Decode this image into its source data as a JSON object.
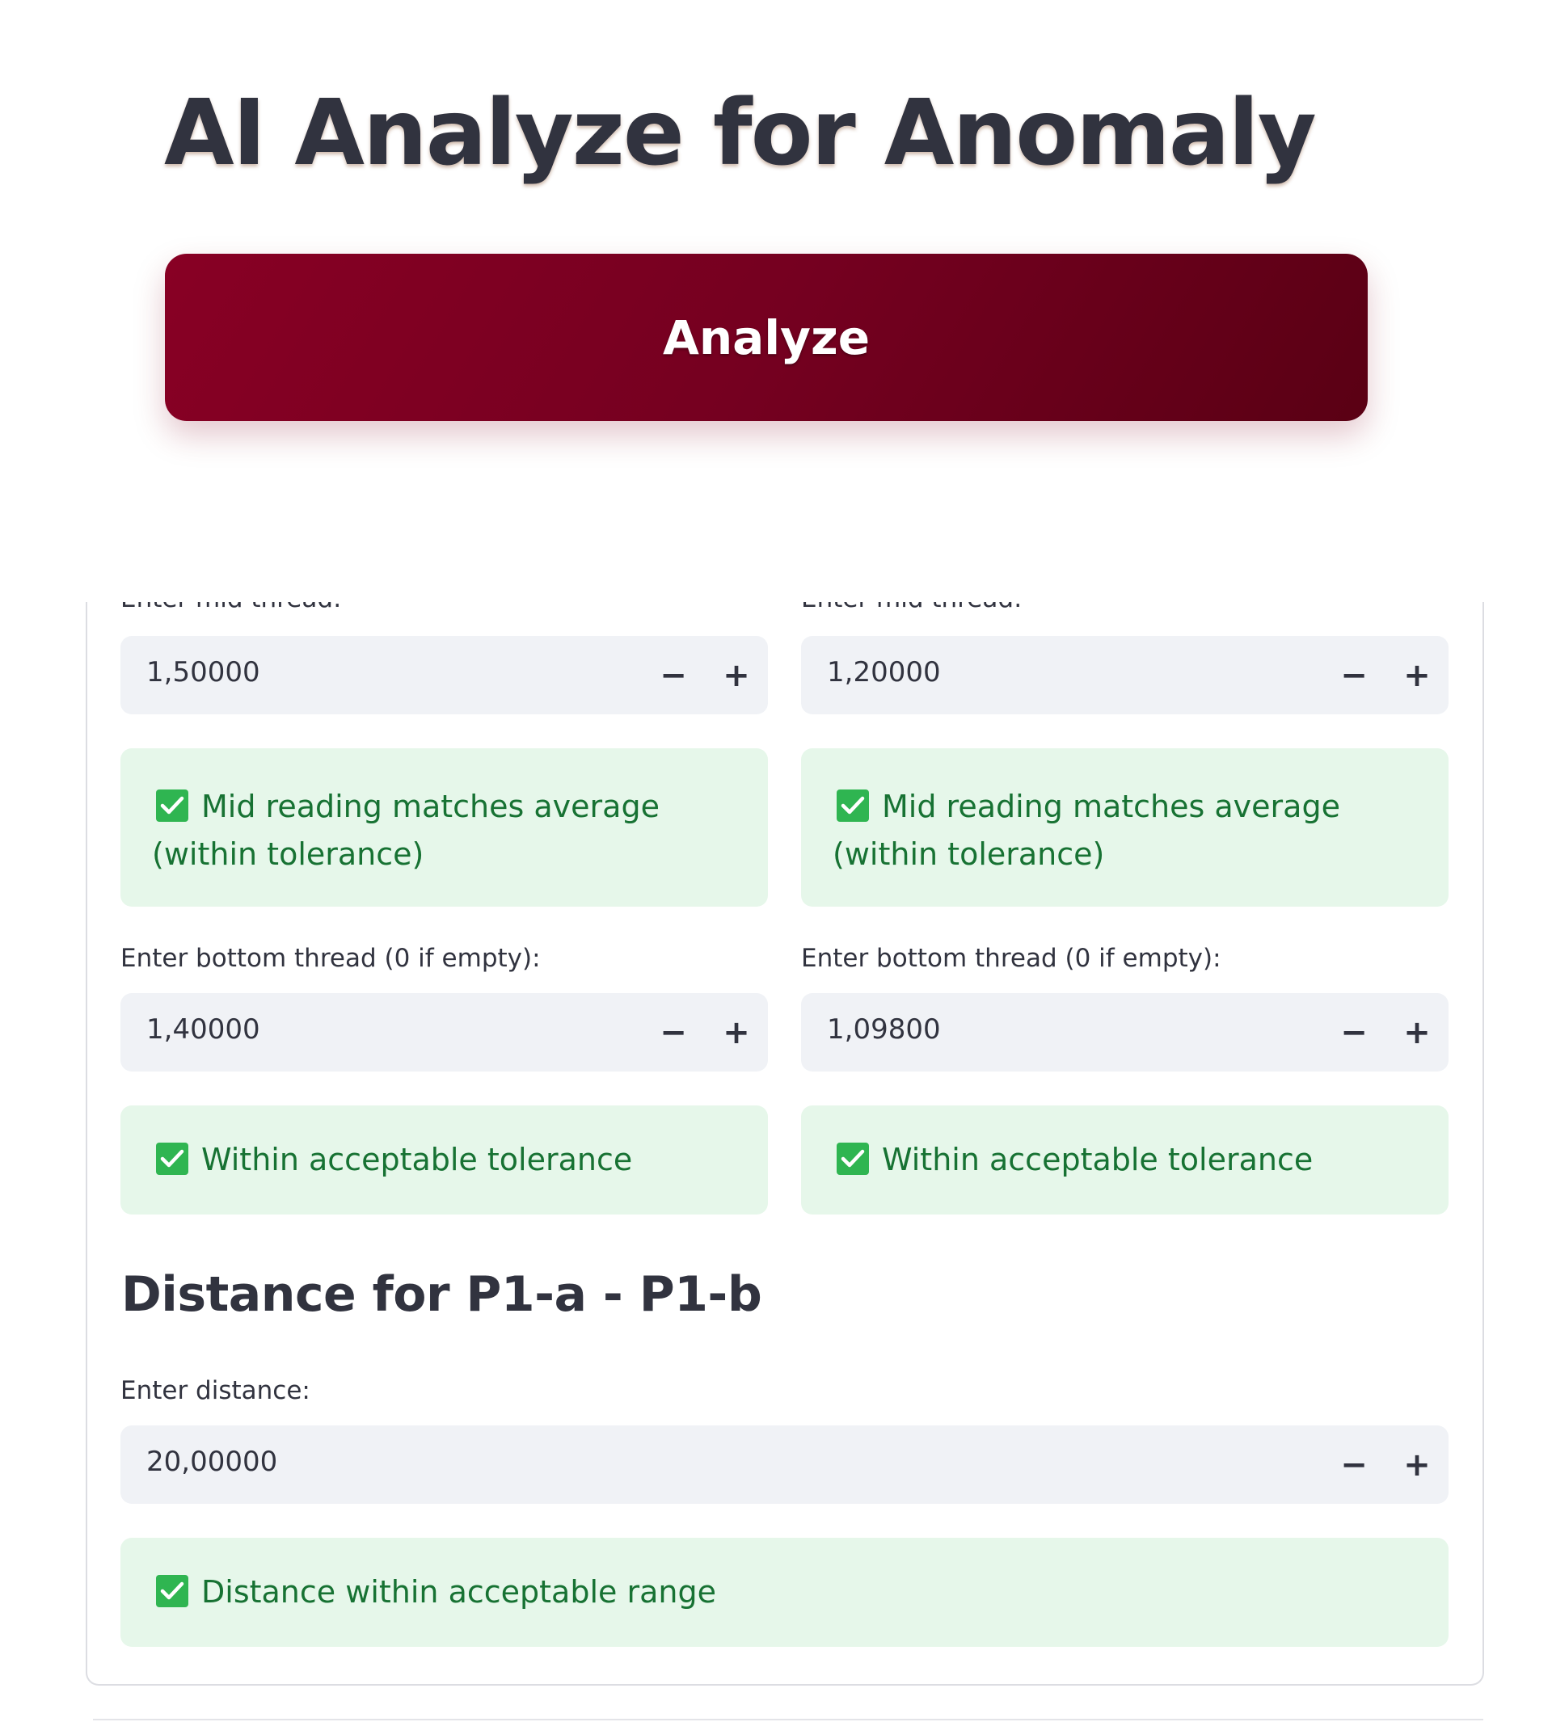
{
  "header": {
    "title": "AI Analyze for Anomaly",
    "analyze_button": "Analyze"
  },
  "columns": [
    {
      "mid_label": "Enter mid thread:",
      "mid_value": "1,50000",
      "mid_message": "Mid reading matches average (within tolerance)",
      "bottom_label": "Enter bottom thread (0 if empty):",
      "bottom_value": "1,40000",
      "bottom_message": "Within acceptable tolerance"
    },
    {
      "mid_label": "Enter mid thread:",
      "mid_value": "1,20000",
      "mid_message": "Mid reading matches average (within tolerance)",
      "bottom_label": "Enter bottom thread (0 if empty):",
      "bottom_value": "1,09800",
      "bottom_message": "Within acceptable tolerance"
    }
  ],
  "distance": {
    "heading": "Distance for P1-a - P1-b",
    "label": "Enter distance:",
    "value": "20,00000",
    "message": "Distance within acceptable range"
  },
  "stepper": {
    "minus": "−",
    "plus": "+"
  },
  "icons": {
    "status": "check-box-icon",
    "decrement": "minus-icon",
    "increment": "plus-icon"
  },
  "colors": {
    "button_start": "#880024",
    "button_end": "#5a0014",
    "success_bg": "#e6f7ea",
    "success_text": "#177233",
    "check_green": "#2fb551",
    "input_bg": "#f0f2f6"
  }
}
